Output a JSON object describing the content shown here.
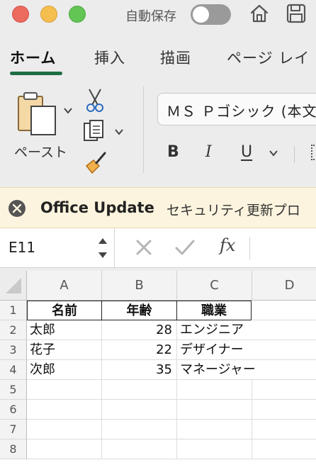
{
  "titlebar": {
    "autosave_label": "自動保存",
    "autosave_on": false
  },
  "tabs": [
    {
      "label": "ホーム",
      "active": true
    },
    {
      "label": "挿入",
      "active": false
    },
    {
      "label": "描画",
      "active": false
    },
    {
      "label": "ページ レイ",
      "active": false
    }
  ],
  "ribbon": {
    "paste_label": "ペースト",
    "font_name": "ＭＳ Ｐゴシック (本文",
    "bold_label": "B",
    "italic_label": "I",
    "underline_label": "U"
  },
  "message_bar": {
    "title": "Office Update",
    "text": "セキュリティ更新プロ"
  },
  "formula_bar": {
    "name_box": "E11",
    "fx_label": "fx"
  },
  "grid": {
    "columns": [
      "A",
      "B",
      "C",
      "D"
    ],
    "rows": [
      "1",
      "2",
      "3",
      "4",
      "5",
      "6",
      "7",
      "8"
    ],
    "header_row": [
      "名前",
      "年齢",
      "職業"
    ],
    "data_rows": [
      [
        "太郎",
        "28",
        "エンジニア"
      ],
      [
        "花子",
        "22",
        "デザイナー"
      ],
      [
        "次郎",
        "35",
        "マネージャー"
      ]
    ]
  },
  "colors": {
    "accent": "#1e6e42",
    "message_bg": "#fcf4de",
    "close_red": "#ed6a5e",
    "min_yellow": "#f5bf4f",
    "max_green": "#62c554"
  }
}
